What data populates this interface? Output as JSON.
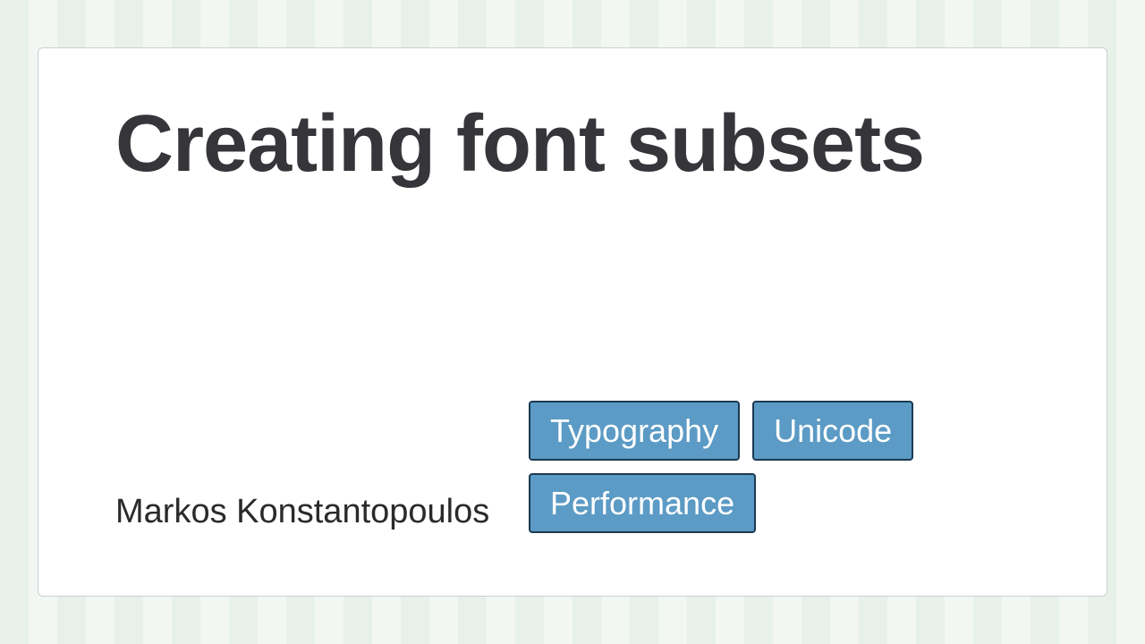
{
  "title": "Creating font subsets",
  "author": "Markos Konstantopoulos",
  "tags": [
    "Typography",
    "Unicode",
    "Performance"
  ]
}
